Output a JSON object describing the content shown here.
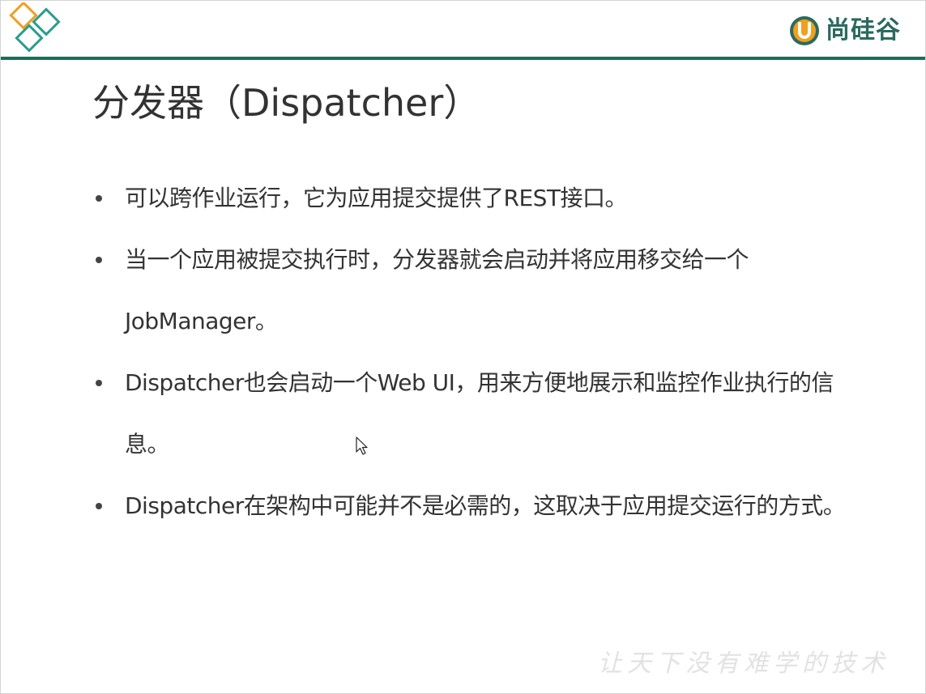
{
  "brand": {
    "name": "尚硅谷",
    "mark_letter": "U",
    "colors": {
      "primary": "#1e6b5a",
      "accent": "#f0a020"
    }
  },
  "corner_logo": {
    "icon": "diamond-logo-icon",
    "colors": [
      "#f0a020",
      "#2a9d8f"
    ]
  },
  "slide": {
    "title": "分发器（Dispatcher）",
    "bullets": [
      {
        "text": "可以跨作业运行，它为应用提交提供了REST接口。"
      },
      {
        "text": "当一个应用被提交执行时，分发器就会启动并将应用移交给一个JobManager。"
      },
      {
        "text": "Dispatcher也会启动一个Web UI，用来方便地展示和监控作业执行的信息。"
      },
      {
        "text": "Dispatcher在架构中可能并不是必需的，这取决于应用提交运行的方式。"
      }
    ]
  },
  "footer": {
    "slogan": "让天下没有难学的技术"
  }
}
